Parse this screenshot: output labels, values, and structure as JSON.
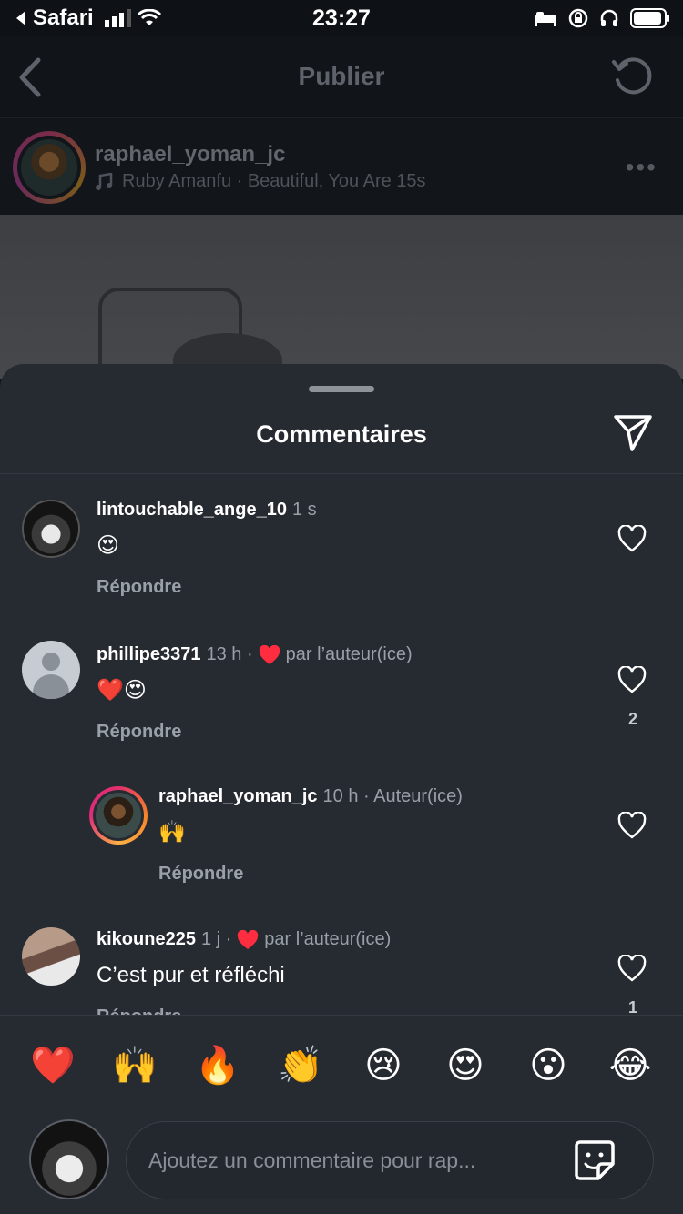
{
  "status_bar": {
    "back_app": "Safari",
    "time": "23:27"
  },
  "header": {
    "title": "Publier"
  },
  "post": {
    "username": "raphael_yoman_jc",
    "music": "Ruby Amanfu · Beautiful, You Are 15s"
  },
  "sheet": {
    "title": "Commentaires"
  },
  "comments": [
    {
      "username": "lintouchable_ange_10",
      "time": "1 s",
      "text": "😍",
      "reply_label": "Répondre",
      "author_liked_label": "",
      "like_count": ""
    },
    {
      "username": "phillipe3371",
      "time": "13 h ·",
      "author_liked_label": "par l’auteur(ice)",
      "text": "❤️😍",
      "reply_label": "Répondre",
      "like_count": "2"
    },
    {
      "username": "raphael_yoman_jc",
      "time": "10 h · Auteur(ice)",
      "text": "🙌",
      "reply_label": "Répondre",
      "like_count": ""
    },
    {
      "username": "kikoune225",
      "time": "1 j ·",
      "author_liked_label": "par l’auteur(ice)",
      "text": "C’est pur et réfléchi",
      "reply_label": "Répondre",
      "like_count": "1"
    }
  ],
  "reactions": [
    "❤️",
    "🙌",
    "🔥",
    "👏",
    "😢",
    "😍",
    "😮",
    "😂"
  ],
  "composer": {
    "placeholder": "Ajoutez un commentaire pour rap..."
  },
  "colors": {
    "sheet_bg": "#262a31",
    "heart_red": "#ff2d3f",
    "meta_grey": "#9aa0a8"
  },
  "icons": {
    "back": "chevron-left-icon",
    "refresh": "refresh-icon",
    "more": "more-icon",
    "music": "music-note-icon",
    "send": "send-icon",
    "like": "heart-outline-icon",
    "sticker": "sticker-icon"
  }
}
